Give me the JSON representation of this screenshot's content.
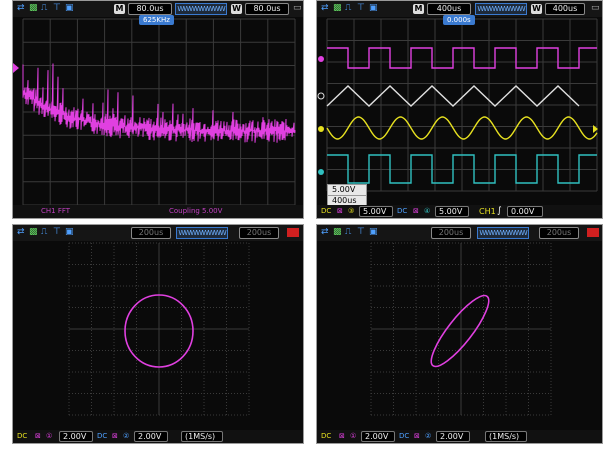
{
  "colors": {
    "ch1": "#e040e0",
    "ch2": "#e0e0e0",
    "ch3": "#e6e020",
    "ch4": "#30c0c0",
    "accent": "#3a7ad0",
    "background": "#0a0a0a"
  },
  "icons": [
    "trigger-mode-icon",
    "run-stop-icon",
    "pulse-trigger-icon",
    "ch-icon",
    "save-icon"
  ],
  "scope1": {
    "mode_label": "M",
    "timebase": "80.0us",
    "window_label": "W",
    "window_timebase": "80.0us",
    "marker": "625KHz",
    "bottom_left": "CH1 FFT",
    "bottom_right": "Coupling 5.00V"
  },
  "scope2": {
    "mode_label": "M",
    "timebase": "400us",
    "window_label": "W",
    "window_timebase": "400us",
    "marker": "0.000s",
    "tag_volt": "5.00V",
    "tag_time": "400us",
    "ch_a_volt": "5.00V",
    "ch_b_volt": "5.00V",
    "trig_label": "CH1",
    "trig_level": "0.00V"
  },
  "scope3": {
    "timebase": "200us",
    "window_timebase": "200us",
    "ch_a_volt": "2.00V",
    "ch_b_volt": "2.00V",
    "sample_rate": "(1MS/s)"
  },
  "scope4": {
    "timebase": "200us",
    "window_timebase": "200us",
    "ch_a_volt": "2.00V",
    "ch_b_volt": "2.00V",
    "sample_rate": "(1MS/s)"
  }
}
